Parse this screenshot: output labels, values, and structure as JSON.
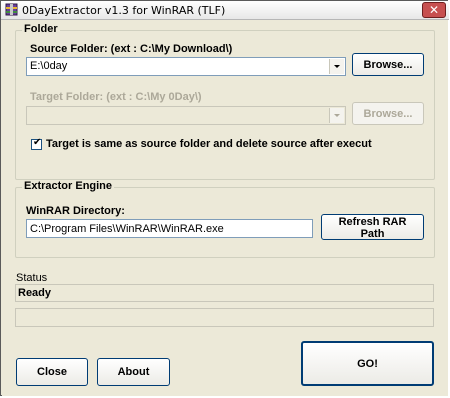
{
  "window": {
    "title": "0DayExtractor v1.3 for WinRAR (TLF)",
    "app_icon": "rar-archive-icon",
    "close_glyph": "✕"
  },
  "folder_group": {
    "title": "Folder",
    "source_label": "Source Folder: (ext : C:\\My Download\\)",
    "source_value": "E:\\0day",
    "source_browse": "Browse...",
    "target_label": "Target Folder: (ext : C:\\My 0Day\\)",
    "target_value": "",
    "target_browse": "Browse...",
    "same_folder_checkbox": {
      "checked": true,
      "label": "Target is same as source folder and delete source after execut"
    }
  },
  "engine_group": {
    "title": "Extractor Engine",
    "dir_label": "WinRAR Directory:",
    "dir_value": "C:\\Program Files\\WinRAR\\WinRAR.exe",
    "refresh_button": "Refresh RAR Path"
  },
  "status": {
    "label": "Status",
    "value": "Ready",
    "progress_fraction": 0
  },
  "buttons": {
    "close": "Close",
    "about": "About",
    "go": "GO!"
  }
}
